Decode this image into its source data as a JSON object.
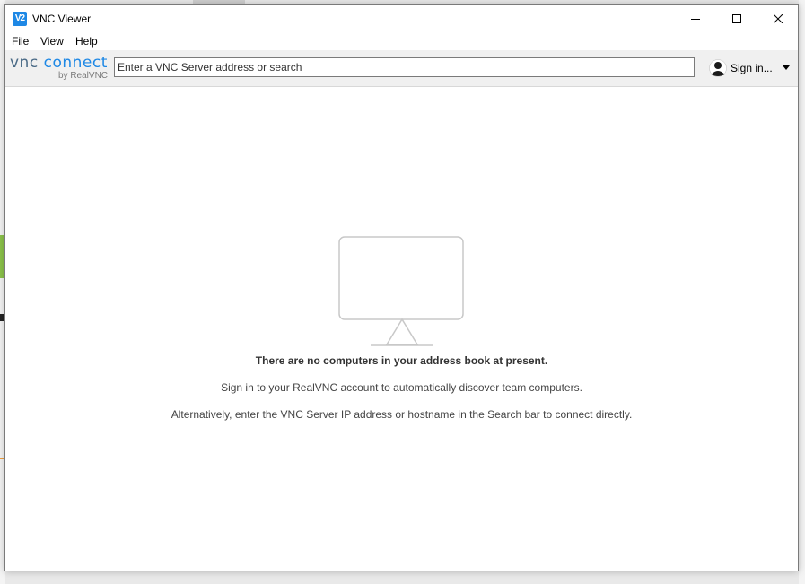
{
  "window": {
    "title": "VNC Viewer",
    "app_icon_text": "V2"
  },
  "menu": {
    "items": [
      "File",
      "View",
      "Help"
    ]
  },
  "toolbar": {
    "brand_vnc": "vnc",
    "brand_connect": "connect",
    "brand_sub": "by RealVNC",
    "search_placeholder": "Enter a VNC Server address or search",
    "sign_in_label": "Sign in..."
  },
  "empty_state": {
    "heading": "There are no computers in your address book at present.",
    "line1": "Sign in to your RealVNC account to automatically discover team computers.",
    "line2": "Alternatively, enter the VNC Server IP address or hostname in the Search bar to connect directly."
  },
  "colors": {
    "accent": "#1e88e5",
    "icon_gray": "#c8c8c8"
  }
}
